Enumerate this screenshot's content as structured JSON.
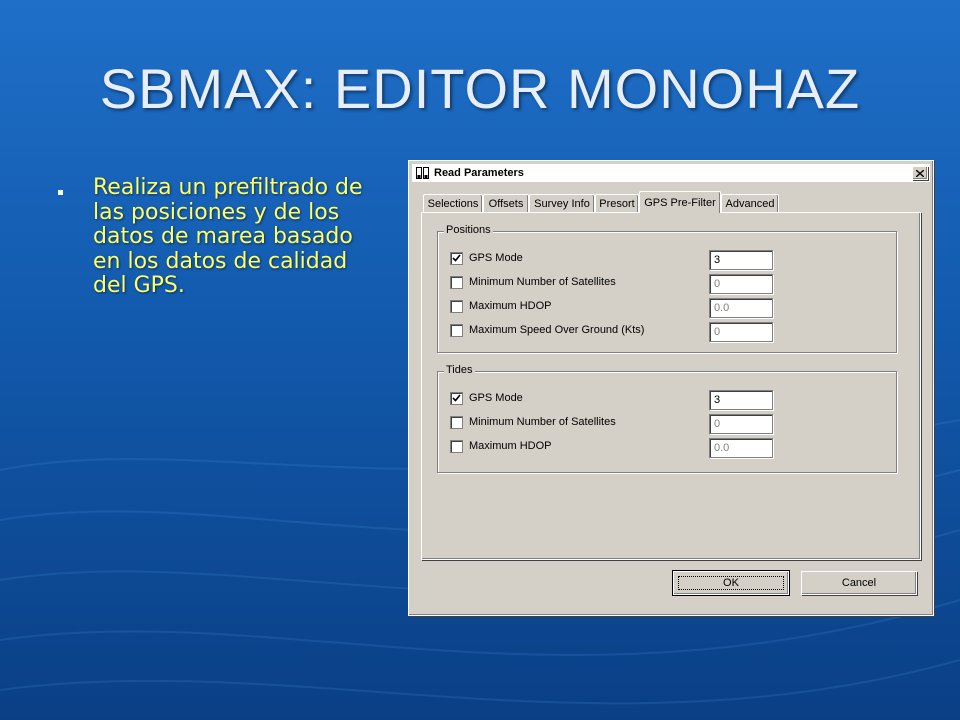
{
  "slide": {
    "title": "SBMAX: EDITOR MONOHAZ",
    "bullet": "Realiza un prefiltrado de las posiciones y de los datos de marea basado en los datos de calidad del GPS."
  },
  "dialog": {
    "title": "Read Parameters",
    "tabs": [
      "Selections",
      "Offsets",
      "Survey Info",
      "Presort",
      "GPS Pre-Filter",
      "Advanced"
    ],
    "active_tab": "GPS Pre-Filter",
    "positions": {
      "legend": "Positions",
      "rows": [
        {
          "label": "GPS Mode",
          "checked": true,
          "value": "3"
        },
        {
          "label": "Minimum Number of Satellites",
          "checked": false,
          "value": "0"
        },
        {
          "label": "Maximum HDOP",
          "checked": false,
          "value": "0.0"
        },
        {
          "label": "Maximum Speed Over Ground (Kts)",
          "checked": false,
          "value": "0"
        }
      ]
    },
    "tides": {
      "legend": "Tides",
      "rows": [
        {
          "label": "GPS Mode",
          "checked": true,
          "value": "3"
        },
        {
          "label": "Minimum Number of Satellites",
          "checked": false,
          "value": "0"
        },
        {
          "label": "Maximum HDOP",
          "checked": false,
          "value": "0.0"
        }
      ]
    },
    "ok_label": "OK",
    "cancel_label": "Cancel"
  },
  "colors": {
    "background_top": "#1f6fc8",
    "background_bottom": "#0a3f85",
    "bullet_text": "#ffff66",
    "dialog_face": "#d4d0c8"
  }
}
